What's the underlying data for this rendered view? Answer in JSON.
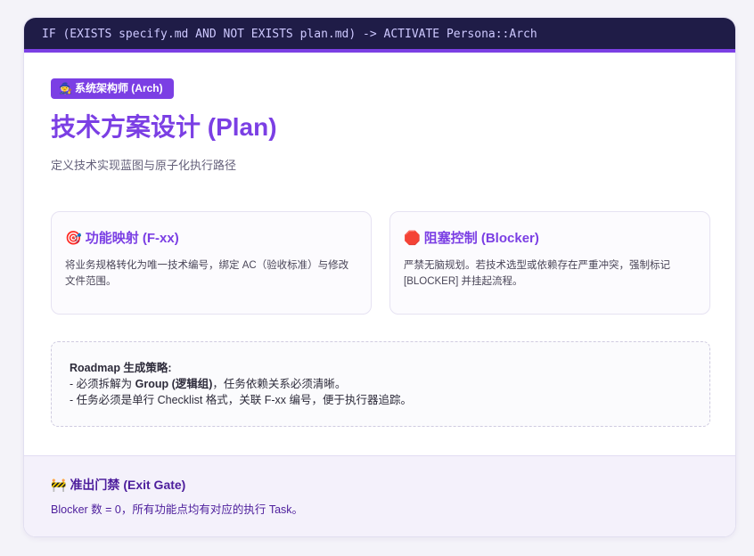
{
  "condition": "IF (EXISTS specify.md AND NOT EXISTS plan.md) -> ACTIVATE Persona::Arch",
  "persona_badge": {
    "emoji": "🧙",
    "label": "系统架构师 (Arch)"
  },
  "title": "技术方案设计 (Plan)",
  "subtitle": "定义技术实现蓝图与原子化执行路径",
  "features": [
    {
      "emoji": "🎯",
      "title": "功能映射 (F-xx)",
      "desc": "将业务规格转化为唯一技术编号，绑定 AC（验收标准）与修改文件范围。"
    },
    {
      "emoji": "🛑",
      "title": "阻塞控制 (Blocker)",
      "desc": "严禁无脑规划。若技术选型或依赖存在严重冲突，强制标记 [BLOCKER] 并挂起流程。"
    }
  ],
  "roadmap": {
    "heading": "Roadmap 生成策略:",
    "line1_prefix": "- 必须拆解为 ",
    "line1_bold": "Group (逻辑组)",
    "line1_suffix": "，任务依赖关系必须清晰。",
    "line2": "- 任务必须是单行 Checklist 格式，关联 F-xx 编号，便于执行器追踪。"
  },
  "exit_gate": {
    "emoji": "🚧",
    "title": "准出门禁 (Exit Gate)",
    "text": "Blocker 数 = 0，所有功能点均有对应的执行 Task。"
  },
  "colors": {
    "accent": "#7b3fe4",
    "topbar_bg": "#1f1c47",
    "footer_bg": "#f4f1fb",
    "gate_text": "#4d1e9c"
  }
}
